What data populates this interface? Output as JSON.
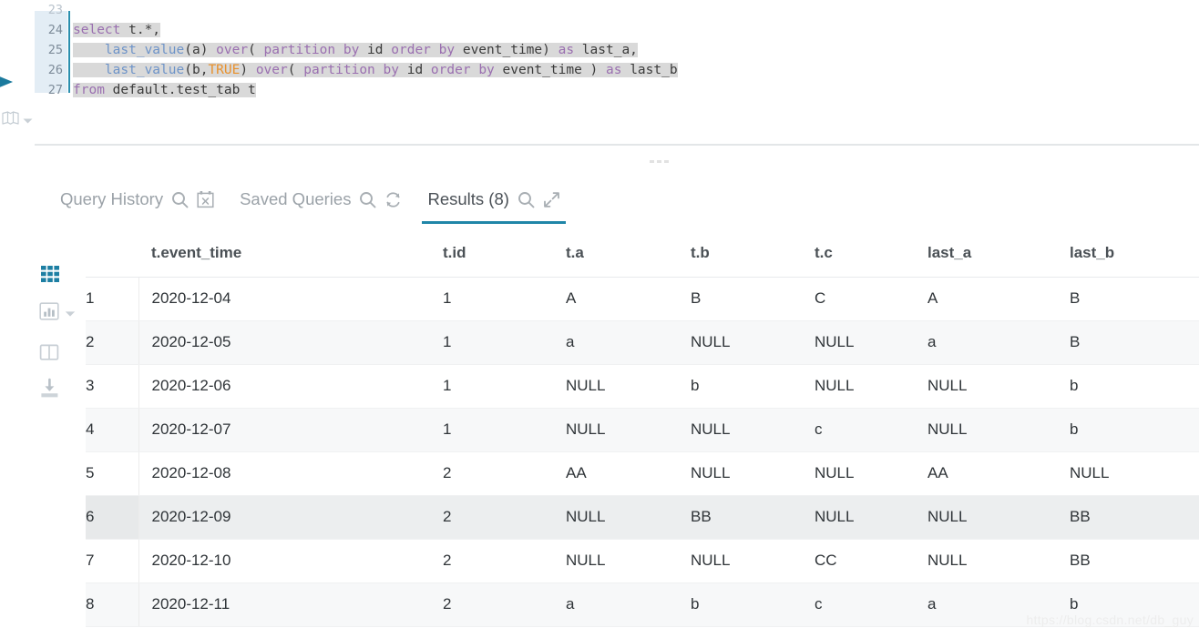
{
  "editor": {
    "gutter_numbers": [
      "23",
      "24",
      "25",
      "26",
      "27"
    ],
    "lines": [
      {
        "n": "23",
        "text": ""
      },
      {
        "n": "24",
        "text": "select t.*,"
      },
      {
        "n": "25",
        "text": "    last_value(a) over( partition by id order by event_time) as last_a,"
      },
      {
        "n": "26",
        "text": "    last_value(b,TRUE) over( partition by id order by event_time ) as last_b"
      },
      {
        "n": "27",
        "text": "from default.test_tab t"
      }
    ],
    "run_icon": "run-play-icon",
    "book_icon": "book-database-icon",
    "book_caret_icon": "chevron-down-icon"
  },
  "tabs": [
    {
      "label": "Query History",
      "active": false,
      "icons": [
        "search-icon",
        "calendar-clear-icon"
      ]
    },
    {
      "label": "Saved Queries",
      "active": false,
      "icons": [
        "search-icon",
        "refresh-icon"
      ]
    },
    {
      "label": "Results (8)",
      "active": true,
      "icons": [
        "search-icon",
        "expand-icon"
      ]
    }
  ],
  "tool_rail": [
    {
      "name": "grid-view-icon",
      "active": true,
      "caret": false
    },
    {
      "name": "chart-view-icon",
      "active": false,
      "caret": true
    },
    {
      "name": "columns-view-icon",
      "active": false,
      "caret": false
    },
    {
      "name": "download-icon",
      "active": false,
      "caret": false
    }
  ],
  "results": {
    "columns": [
      "",
      "t.event_time",
      "t.id",
      "t.a",
      "t.b",
      "t.c",
      "last_a",
      "last_b"
    ],
    "hover_row_index": 5,
    "rows": [
      [
        "1",
        "2020-12-04",
        "1",
        "A",
        "B",
        "C",
        "A",
        "B"
      ],
      [
        "2",
        "2020-12-05",
        "1",
        "a",
        "NULL",
        "NULL",
        "a",
        "B"
      ],
      [
        "3",
        "2020-12-06",
        "1",
        "NULL",
        "b",
        "NULL",
        "NULL",
        "b"
      ],
      [
        "4",
        "2020-12-07",
        "1",
        "NULL",
        "NULL",
        "c",
        "NULL",
        "b"
      ],
      [
        "5",
        "2020-12-08",
        "2",
        "AA",
        "NULL",
        "NULL",
        "AA",
        "NULL"
      ],
      [
        "6",
        "2020-12-09",
        "2",
        "NULL",
        "BB",
        "NULL",
        "NULL",
        "BB"
      ],
      [
        "7",
        "2020-12-10",
        "2",
        "NULL",
        "NULL",
        "CC",
        "NULL",
        "BB"
      ],
      [
        "8",
        "2020-12-11",
        "2",
        "a",
        "b",
        "c",
        "a",
        "b"
      ]
    ]
  },
  "watermark": "https://blog.csdn.net/db_guy",
  "colors": {
    "accent": "#1f86a8",
    "keyword": "#9a6fb0",
    "function": "#6d93c8",
    "literal": "#e8912d",
    "selection": "#d9d9d9",
    "gutter_highlight": "#e3edf5",
    "row_stripe": "#f7f8f9",
    "row_hover": "#eceeef"
  }
}
